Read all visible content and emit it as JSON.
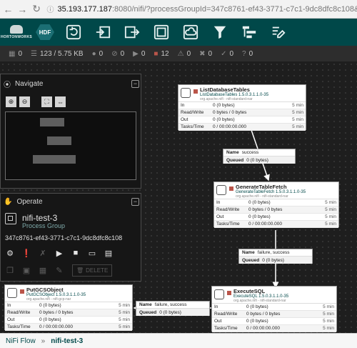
{
  "browser": {
    "url_host": "35.193.177.187",
    "url_rest": ":8080/nifi/?processGroupId=347c8761-ef43-3771-c7c1-9dc8dfc8c108&comp"
  },
  "header": {
    "logo_text": "HORTONWORKS",
    "hdf_label": "HDF",
    "tools": [
      "processor-icon",
      "input-port-icon",
      "output-port-icon",
      "process-group-icon",
      "remote-process-group-icon",
      "funnel-icon",
      "template-icon",
      "label-icon"
    ]
  },
  "stats": {
    "active_threads": "0",
    "queued": "123 / 5.75 KB",
    "transmitting": "0",
    "not_transmitting": "0",
    "running": "0",
    "stopped": "12",
    "invalid": "0",
    "disabled": "0",
    "up_to_date": "0",
    "sync_failure": "0"
  },
  "navigate": {
    "title": "Navigate"
  },
  "operate": {
    "title": "Operate",
    "name": "nifi-test-3",
    "type": "Process Group",
    "id": "347c8761-ef43-3771-c7c1-9dc8dfc8c108",
    "delete_label": "DELETE"
  },
  "processors": [
    {
      "name": "ListDatabaseTables",
      "type": "ListDatabaseTables 1.5.0.3.1.1.0-35",
      "bundle": "org.apache.nifi - nifi-standard-nar",
      "rows": [
        {
          "k": "In",
          "v": "0 (0 bytes)",
          "t": "5 min"
        },
        {
          "k": "Read/Write",
          "v": "0 bytes / 0 bytes",
          "t": "5 min"
        },
        {
          "k": "Out",
          "v": "0 (0 bytes)",
          "t": "5 min"
        },
        {
          "k": "Tasks/Time",
          "v": "0 / 00:00:00.000",
          "t": "5 min"
        }
      ]
    },
    {
      "name": "GenerateTableFetch",
      "type": "GenerateTableFetch 1.5.0.3.1.1.0-35",
      "bundle": "org.apache.nifi - nifi-standard-nar",
      "rows": [
        {
          "k": "In",
          "v": "0 (0 bytes)",
          "t": "5 min"
        },
        {
          "k": "Read/Write",
          "v": "0 bytes / 0 bytes",
          "t": "5 min"
        },
        {
          "k": "Out",
          "v": "0 (0 bytes)",
          "t": "5 min"
        },
        {
          "k": "Tasks/Time",
          "v": "0 / 00:00:00.000",
          "t": "5 min"
        }
      ]
    },
    {
      "name": "PutGCSObject",
      "type": "PutGCSObject 1.5.0.3.1.1.0-35",
      "bundle": "org.apache.nifi - nifi-gcp-nar",
      "rows": [
        {
          "k": "In",
          "v": "0 (0 bytes)",
          "t": "5 min"
        },
        {
          "k": "Read/Write",
          "v": "0 bytes / 0 bytes",
          "t": "5 min"
        },
        {
          "k": "Out",
          "v": "0 (0 bytes)",
          "t": "5 min"
        },
        {
          "k": "Tasks/Time",
          "v": "0 / 00:00:00.000",
          "t": "5 min"
        }
      ]
    },
    {
      "name": "ExecuteSQL",
      "type": "ExecuteSQL 1.5.0.3.1.1.0-35",
      "bundle": "org.apache.nifi - nifi-standard-nar",
      "rows": [
        {
          "k": "In",
          "v": "0 (0 bytes)",
          "t": "5 min"
        },
        {
          "k": "Read/Write",
          "v": "0 bytes / 0 bytes",
          "t": "5 min"
        },
        {
          "k": "Out",
          "v": "0 (0 bytes)",
          "t": "5 min"
        },
        {
          "k": "Tasks/Time",
          "v": "0 / 00:00:00.000",
          "t": "5 min"
        }
      ]
    }
  ],
  "connections": [
    {
      "name_label": "Name",
      "name": "success",
      "queued_label": "Queued",
      "queued": "0 (0 bytes)"
    },
    {
      "name_label": "Name",
      "name": "failure, success",
      "queued_label": "Queued",
      "queued": "0 (0 bytes)"
    },
    {
      "name_label": "Name",
      "name": "failure, success",
      "queued_label": "Queued",
      "queued": "0 (0 bytes)"
    }
  ],
  "breadcrumb": {
    "root": "NiFi Flow",
    "sep": "»",
    "current": "nifi-test-3"
  },
  "colors": {
    "header_bg": "#004849",
    "stopped_red": "#ba554a",
    "canvas_bg": "#1e1e1e"
  }
}
